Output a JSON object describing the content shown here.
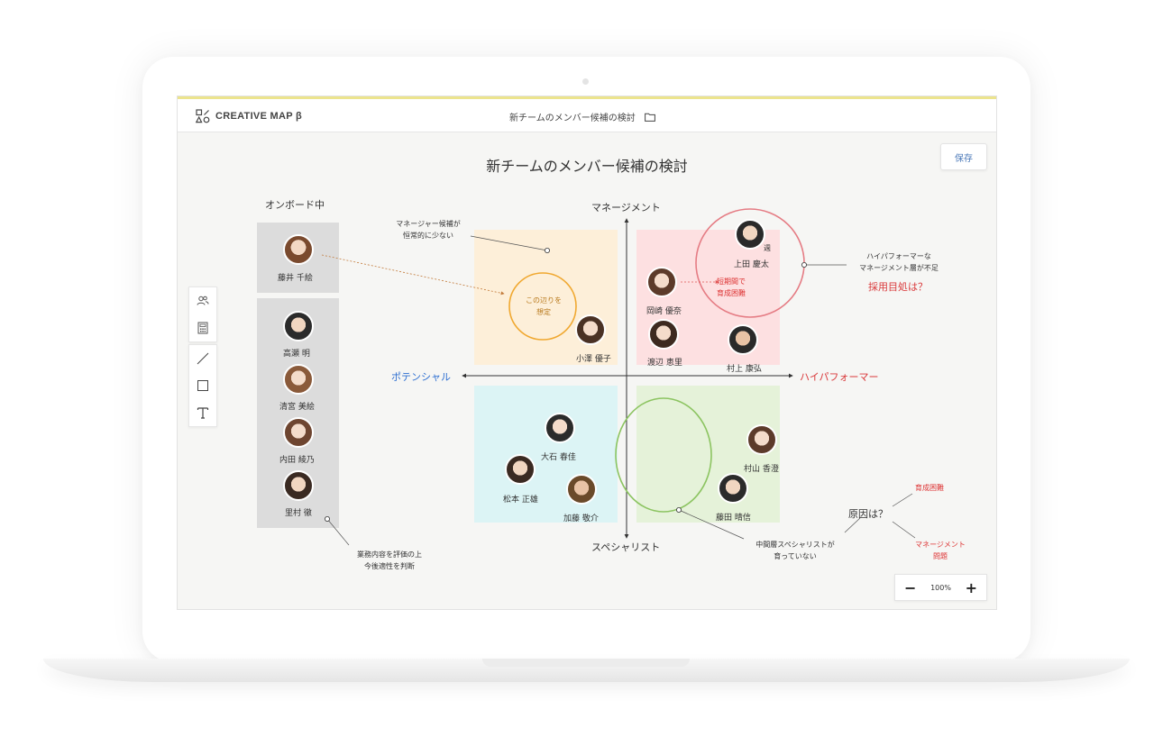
{
  "app": {
    "logo_text": "CREATIVE MAP β",
    "doc_title": "新チームのメンバー候補の検討"
  },
  "toolbar": {
    "save_label": "保存"
  },
  "map": {
    "title": "新チームのメンバー候補の検討",
    "onboard_label": "オンボード中",
    "axes": {
      "top": "マネージメント",
      "bottom": "スペシャリスト",
      "left": "ポテンシャル",
      "right": "ハイパフォーマー"
    },
    "onboarding_members": [
      {
        "name": "藤井 千絵"
      }
    ],
    "pool_members": [
      {
        "name": "高瀬 明"
      },
      {
        "name": "清宮 美絵"
      },
      {
        "name": "内田 綾乃"
      },
      {
        "name": "里村 徹"
      }
    ],
    "quadrant_members": {
      "top_left": [
        {
          "name": "小澤 優子"
        }
      ],
      "top_right": [
        {
          "name": "上田 慶太"
        },
        {
          "name": "岡崎 優奈"
        },
        {
          "name": "渡辺 恵里"
        },
        {
          "name": "村上 康弘"
        }
      ],
      "bottom_left": [
        {
          "name": "大石 春佳"
        },
        {
          "name": "松本 正雄"
        },
        {
          "name": "加藤 敬介"
        }
      ],
      "bottom_right": [
        {
          "name": "村山 香澄"
        },
        {
          "name": "藤田 晴信"
        }
      ]
    },
    "badge": "週",
    "circle_label_line1": "この辺りを",
    "circle_label_line2": "想定",
    "notes": {
      "manager_line1": "マネージャー候補が",
      "manager_line2": "恒常的に少ない",
      "hp_line1": "ハイパフォーマーな",
      "hp_line2": "マネージメント層が不足",
      "hiring": "採用目処は？",
      "short_line1": "短期間で",
      "short_line2": "育成困難",
      "eval_line1": "業務内容を評価の上",
      "eval_line2": "今後適性を判断",
      "mid_line1": "中間層スペシャリストが",
      "mid_line2": "育っていない",
      "cause": "原因は？",
      "cause_a": "育成困難",
      "cause_b_line1": "マネージメント",
      "cause_b_line2": "問題"
    }
  },
  "zoom": {
    "minus": "−",
    "value": "100%",
    "plus": "+"
  },
  "colors": {
    "quad_top_left": "#fdefd9",
    "quad_top_right": "#fde0e1",
    "quad_bottom_left": "#dcf4f5",
    "quad_bottom_right": "#e5f2d9",
    "accent_blue": "#2e6fd1",
    "accent_red": "#d9383a"
  }
}
